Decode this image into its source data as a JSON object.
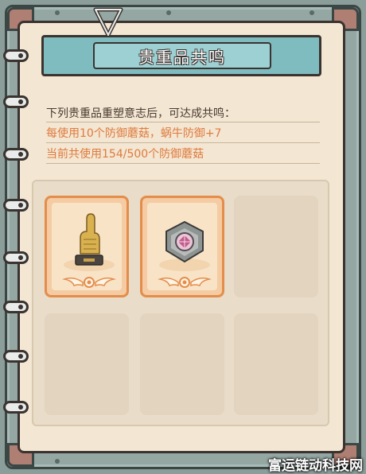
{
  "header": {
    "title": "贵重品共鸣"
  },
  "info": {
    "intro": "下列贵重品重塑意志后，可达成共鸣：",
    "effect": "每使用10个防御蘑菇，蜗牛防御+7",
    "progress": "当前共使用154/500个防御蘑菇"
  },
  "slots": [
    {
      "state": "filled",
      "item_icon": "golden-fist-trophy-icon"
    },
    {
      "state": "filled",
      "item_icon": "gem-shield-emblem-icon"
    },
    {
      "state": "empty"
    },
    {
      "state": "empty"
    },
    {
      "state": "empty"
    },
    {
      "state": "empty"
    }
  ],
  "watermark": "富运链动科技网",
  "colors": {
    "accent": "#df7a3d",
    "banner": "#7fbcc0",
    "page": "#f3e6d2"
  }
}
